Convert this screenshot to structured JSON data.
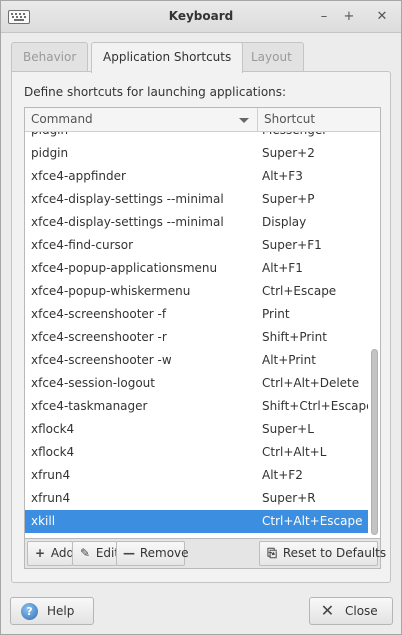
{
  "window": {
    "title": "Keyboard",
    "controls": {
      "minimize": "–",
      "maximize": "+",
      "close": "✕"
    }
  },
  "tabs": [
    {
      "label": "Behavior",
      "active": false
    },
    {
      "label": "Application Shortcuts",
      "active": true
    },
    {
      "label": "Layout",
      "active": false
    }
  ],
  "panel": {
    "description": "Define shortcuts for launching applications:",
    "columns": {
      "command": "Command",
      "shortcut": "Shortcut"
    }
  },
  "shortcuts": [
    {
      "command": "pidgin",
      "shortcut": "Messenger"
    },
    {
      "command": "pidgin",
      "shortcut": "Super+2"
    },
    {
      "command": "xfce4-appfinder",
      "shortcut": "Alt+F3"
    },
    {
      "command": "xfce4-display-settings --minimal",
      "shortcut": "Super+P"
    },
    {
      "command": "xfce4-display-settings --minimal",
      "shortcut": "Display"
    },
    {
      "command": "xfce4-find-cursor",
      "shortcut": "Super+F1"
    },
    {
      "command": "xfce4-popup-applicationsmenu",
      "shortcut": "Alt+F1"
    },
    {
      "command": "xfce4-popup-whiskermenu",
      "shortcut": "Ctrl+Escape"
    },
    {
      "command": "xfce4-screenshooter -f",
      "shortcut": "Print"
    },
    {
      "command": "xfce4-screenshooter -r",
      "shortcut": "Shift+Print"
    },
    {
      "command": "xfce4-screenshooter -w",
      "shortcut": "Alt+Print"
    },
    {
      "command": "xfce4-session-logout",
      "shortcut": "Ctrl+Alt+Delete"
    },
    {
      "command": "xfce4-taskmanager",
      "shortcut": "Shift+Ctrl+Escape"
    },
    {
      "command": "xflock4",
      "shortcut": "Super+L"
    },
    {
      "command": "xflock4",
      "shortcut": "Ctrl+Alt+L"
    },
    {
      "command": "xfrun4",
      "shortcut": "Alt+F2"
    },
    {
      "command": "xfrun4",
      "shortcut": "Super+R"
    },
    {
      "command": "xkill",
      "shortcut": "Ctrl+Alt+Escape",
      "selected": true
    }
  ],
  "toolbar": {
    "add": {
      "icon": "+",
      "label": "Add"
    },
    "edit": {
      "icon": "✎",
      "label": "Edit"
    },
    "remove": {
      "icon": "—",
      "label": "Remove"
    },
    "reset": {
      "icon": "⎘",
      "label": "Reset to Defaults"
    }
  },
  "footer": {
    "help": {
      "icon": "?",
      "label": "Help"
    },
    "close": {
      "icon": "✕",
      "label": "Close"
    }
  },
  "colors": {
    "selection": "#3b8ee0",
    "window_bg": "#ececec"
  }
}
